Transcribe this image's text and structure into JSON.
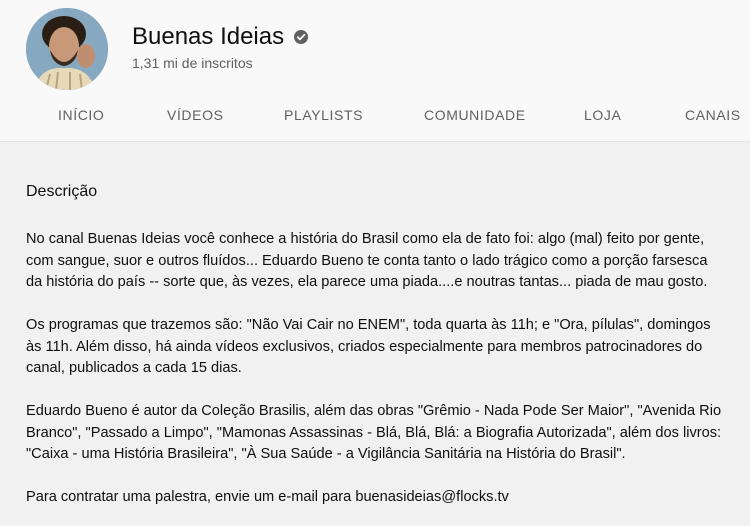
{
  "channel": {
    "name": "Buenas Ideias",
    "subscribers": "1,31 mi de inscritos"
  },
  "tabs": [
    {
      "label": "INÍCIO"
    },
    {
      "label": "VÍDEOS"
    },
    {
      "label": "PLAYLISTS"
    },
    {
      "label": "COMUNIDADE"
    },
    {
      "label": "LOJA"
    },
    {
      "label": "CANAIS"
    }
  ],
  "about": {
    "title": "Descrição",
    "paragraphs": [
      "No canal Buenas Ideias você conhece a história do Brasil como ela de fato foi: algo (mal) feito por gente, com sangue, suor e outros fluídos... Eduardo Bueno te conta tanto o lado trágico como a porção farsesca da história do país -- sorte que, às vezes, ela parece uma piada....e noutras tantas... piada de mau gosto.",
      "Os programas que trazemos são: \"Não Vai Cair no ENEM\", toda quarta às 11h; e \"Ora, pílulas\", domingos às 11h. Além disso, há ainda vídeos exclusivos, criados especialmente para membros patrocinadores do canal, publicados a cada 15 dias.",
      "Eduardo Bueno é autor da Coleção Brasilis, além das obras \"Grêmio - Nada Pode Ser Maior\", \"Avenida Rio Branco\", \"Passado a Limpo\", \"Mamonas Assassinas - Blá, Blá, Blá: a Biografia Autorizada\",  além dos livros: \"Caixa - uma História Brasileira\", \"À Sua Saúde - a Vigilância Sanitária na História do Brasil\".",
      "Para contratar uma palestra, envie um e-mail para buenasideias@flocks.tv"
    ]
  },
  "colors": {
    "header_bg": "#f9f9f9",
    "content_bg": "#f1f1f1",
    "text_primary": "#0f0f0f",
    "text_secondary": "#606060"
  },
  "icons": {
    "verified": "verified-check-icon"
  }
}
